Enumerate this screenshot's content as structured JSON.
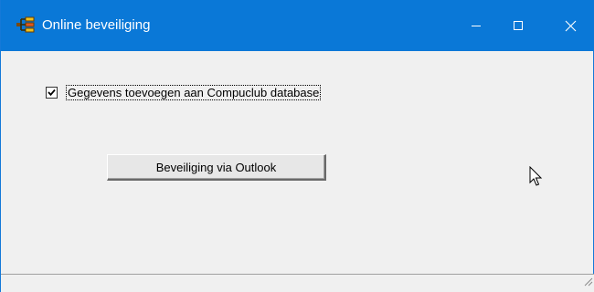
{
  "window": {
    "title": "Online beveiliging",
    "icon": "app-tree-icon"
  },
  "caption_buttons": {
    "minimize_icon": "minimize-icon",
    "maximize_icon": "maximize-icon",
    "close_icon": "close-icon"
  },
  "form": {
    "checkbox_label": "Gegevens toevoegen aan Compuclub database",
    "checkbox_checked": true,
    "button_label": "Beveiliging via Outlook"
  },
  "colors": {
    "titlebar": "#0a78d7",
    "window_bg": "#f0f0f0"
  }
}
